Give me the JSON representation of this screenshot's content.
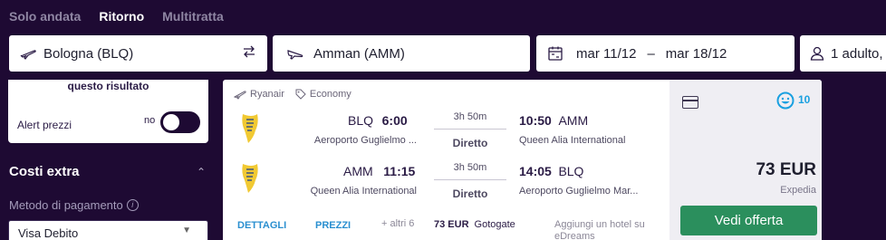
{
  "tabs": [
    {
      "label": "Solo andata",
      "active": false
    },
    {
      "label": "Ritorno",
      "active": true
    },
    {
      "label": "Multitratta",
      "active": false
    }
  ],
  "search": {
    "from": "Bologna (BLQ)",
    "to": "Amman (AMM)",
    "date_out": "mar 11/12",
    "date_sep": "–",
    "date_return": "mar 18/12",
    "passengers": "1 adulto,"
  },
  "filters": {
    "alert_heading": "questo risultato",
    "alert_label": "Alert prezzi",
    "alert_state": "no",
    "extra_costs_title": "Costi extra",
    "payment_label": "Metodo di pagamento",
    "payment_value": "Visa Debito"
  },
  "result": {
    "airline": "Ryanair",
    "cabin": "Economy",
    "outbound": {
      "dep_code": "BLQ",
      "dep_time": "6:00",
      "duration": "3h 50m",
      "stops": "Diretto",
      "arr_time": "10:50",
      "arr_code": "AMM",
      "dep_airport": "Aeroporto Guglielmo ...",
      "arr_airport": "Queen Alia International"
    },
    "return": {
      "dep_code": "AMM",
      "dep_time": "11:15",
      "duration": "3h 50m",
      "stops": "Diretto",
      "arr_time": "14:05",
      "arr_code": "BLQ",
      "dep_airport": "Queen Alia International",
      "arr_airport": "Aeroporto Guglielmo Mar..."
    },
    "details_link": "DETTAGLI",
    "prices_link": "PREZZI",
    "others_count": "+ altri 6",
    "alt_price": "73 EUR",
    "alt_provider": "Gotogate",
    "hotel_text": "Aggiungi un hotel su eDreams",
    "score": "10",
    "price": "73 EUR",
    "provider": "Expedia",
    "cta": "Vedi offerta"
  },
  "colors": {
    "background": "#1e0a33",
    "accent_link": "#2a8fd0",
    "cta_green": "#2b8f5d",
    "score_blue": "#1aa0e0"
  }
}
